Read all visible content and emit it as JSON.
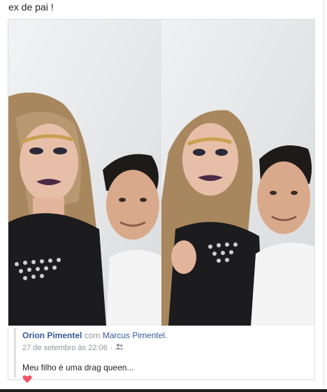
{
  "post": {
    "top_text": "ex de pai !",
    "author": "Orion Pimentel",
    "with_word": "com",
    "tagged": "Marcus Pimentel.",
    "date": "27 de setembro às 22:06",
    "separator": "·",
    "caption": "Meu filho é uma drag queen...",
    "audience_icon": "friends-icon",
    "reaction_icon": "heart-icon"
  },
  "colors": {
    "link": "#365899",
    "meta_gray": "#90949c",
    "heart": "#f25268"
  }
}
